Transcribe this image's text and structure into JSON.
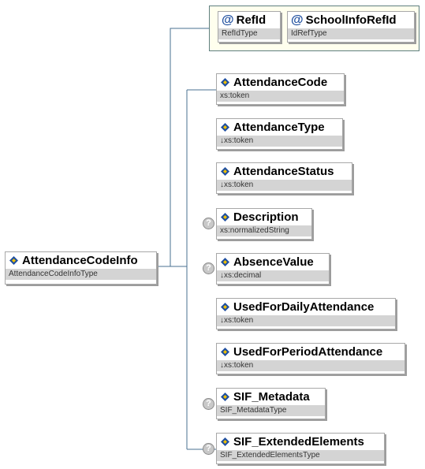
{
  "root": {
    "name": "AttendanceCodeInfo",
    "type": "AttendanceCodeInfoType"
  },
  "attributes": [
    {
      "name": "RefId",
      "type": "RefIdType"
    },
    {
      "name": "SchoolInfoRefId",
      "type": "IdRefType"
    }
  ],
  "elements": [
    {
      "name": "AttendanceCode",
      "type": "xs:token"
    },
    {
      "name": "AttendanceType",
      "type": "↓xs:token"
    },
    {
      "name": "AttendanceStatus",
      "type": "↓xs:token"
    },
    {
      "name": "Description",
      "type": "xs:normalizedString"
    },
    {
      "name": "AbsenceValue",
      "type": "↓xs:decimal"
    },
    {
      "name": "UsedForDailyAttendance",
      "type": "↓xs:token"
    },
    {
      "name": "UsedForPeriodAttendance",
      "type": "↓xs:token"
    },
    {
      "name": "SIF_Metadata",
      "type": "SIF_MetadataType"
    },
    {
      "name": "SIF_ExtendedElements",
      "type": "SIF_ExtendedElementsType"
    }
  ],
  "icons": {
    "element": "element-diamond-icon",
    "attribute": "at-sign-icon",
    "optional": "question-mark-icon"
  },
  "colors": {
    "connector": "#4a7090",
    "attribute_group_bg": "#ffffee",
    "type_bar": "#d4d4d4",
    "element_icon_blue": "#1f4fa0",
    "element_icon_yellow": "#f0c000"
  }
}
